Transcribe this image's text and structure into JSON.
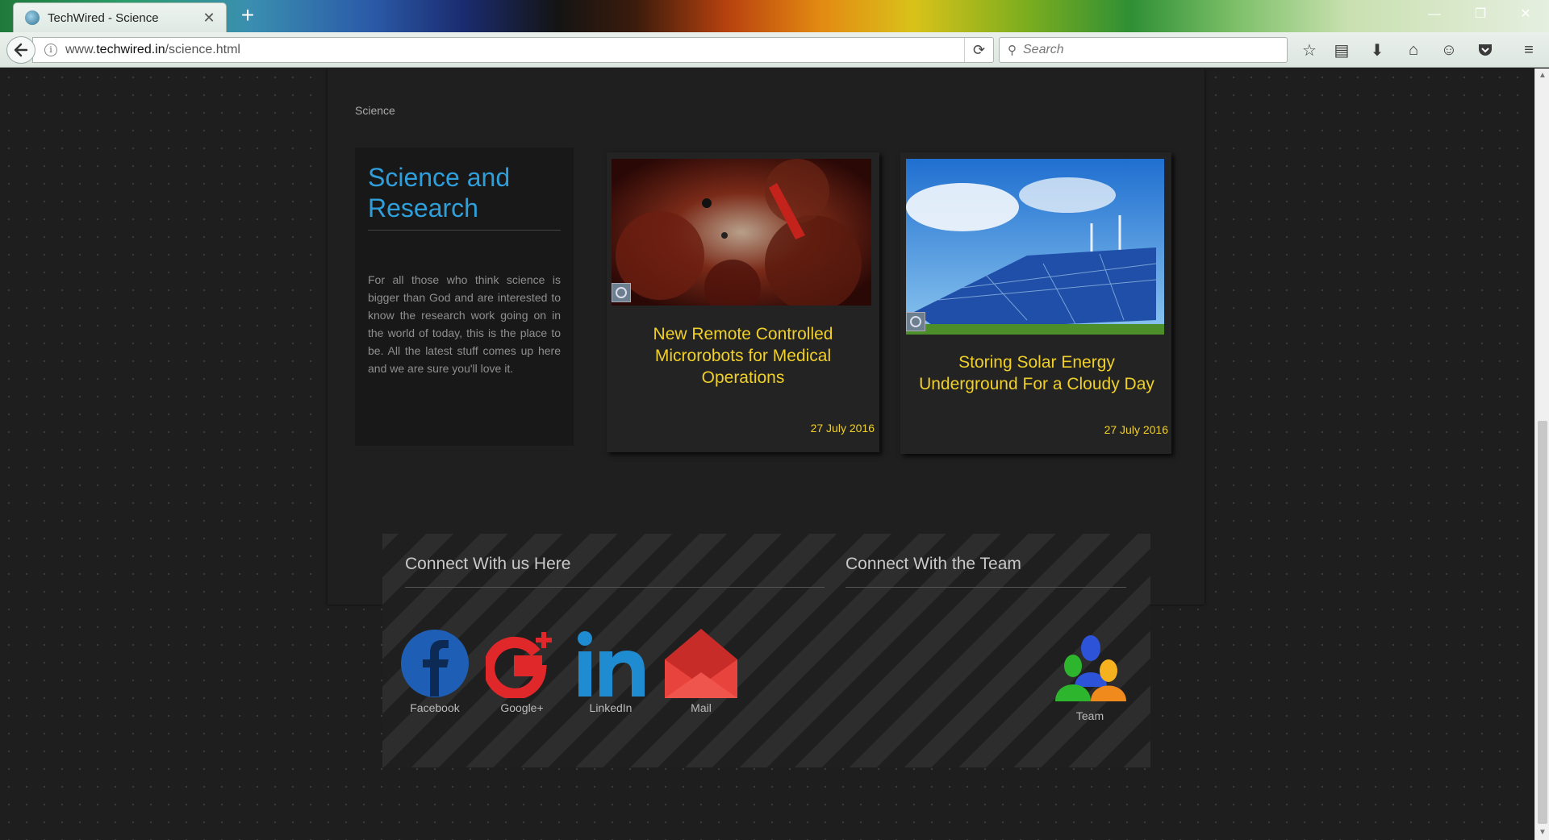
{
  "browser": {
    "tab_title": "TechWired - Science",
    "tab_close": "✕",
    "new_tab": "+",
    "url_prefix": "www.",
    "url_domain": "techwired.in",
    "url_path": "/science.html",
    "search_placeholder": "Search",
    "window_controls": {
      "minimize": "—",
      "restore": "❐",
      "close": "✕"
    }
  },
  "page": {
    "breadcrumb": "Science",
    "intro": {
      "title": "Science and Research",
      "text": "For all those who think science is bigger than God and are interested to know the research work going on in the world of today, this is the place to be. All the latest stuff comes up here and we are sure you'll love it."
    },
    "articles": [
      {
        "title": "New Remote Controlled Microrobots for Medical Operations",
        "date": "27 July 2016"
      },
      {
        "title": "Storing Solar Energy Underground For a Cloudy Day",
        "date": "27 July 2016"
      }
    ],
    "footer": {
      "connect_heading": "Connect With us Here",
      "team_heading": "Connect With the Team",
      "links": [
        {
          "label": "Facebook",
          "color": "#1e5fb5"
        },
        {
          "label": "Google+",
          "color": "#e0282a"
        },
        {
          "label": "LinkedIn",
          "color": "#1f8bd1"
        },
        {
          "label": "Mail",
          "color": "#e8433c"
        }
      ],
      "team_label": "Team"
    }
  },
  "colors": {
    "accent_blue": "#2e9fdb",
    "article_yellow": "#f0d028"
  }
}
